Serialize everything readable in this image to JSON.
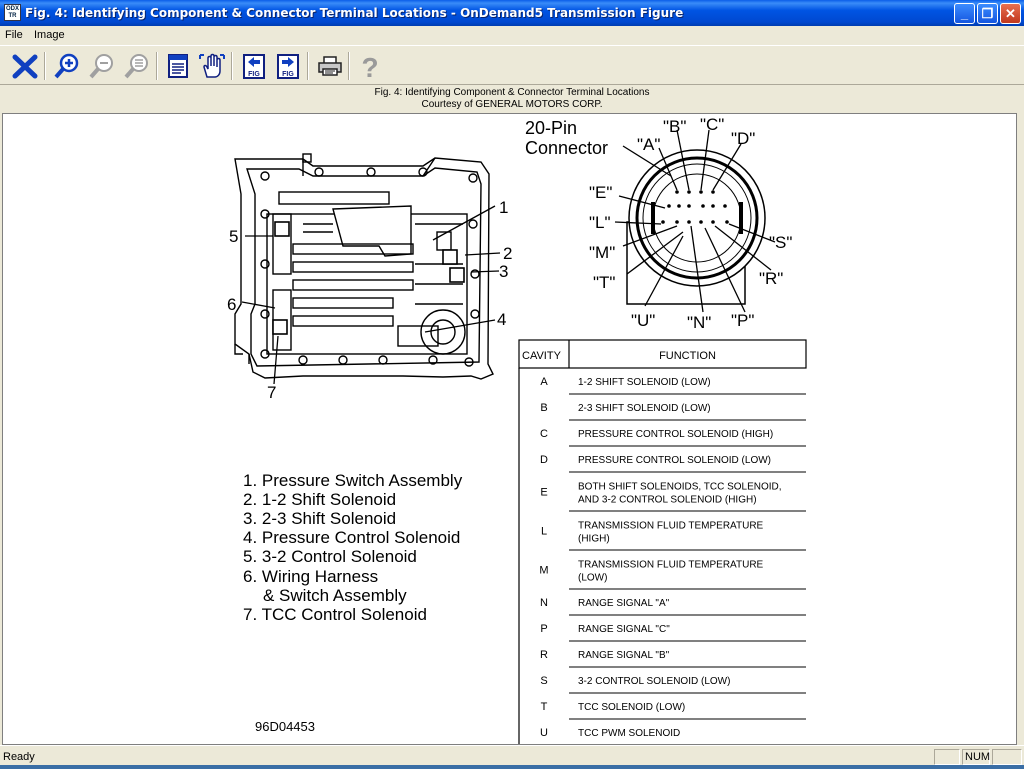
{
  "window": {
    "app_icon_text": "ODX TR",
    "title": "Fig. 4: Identifying Component & Connector Terminal Locations - OnDemand5 Transmission Figure",
    "minimize": "_",
    "maximize": "❐",
    "close": "✕"
  },
  "menu": {
    "file": "File",
    "image": "Image"
  },
  "toolbar": {
    "help_glyph": "?",
    "fig_prev_label": "FIG",
    "fig_next_label": "FIG"
  },
  "caption": {
    "line1": "Fig. 4: Identifying Component & Connector Terminal Locations",
    "line2": "Courtesy of GENERAL MOTORS CORP."
  },
  "figure": {
    "connector_label_1": "20-Pin",
    "connector_label_2": "Connector",
    "pins": [
      "\"A\"",
      "\"B\"",
      "\"C\"",
      "\"D\"",
      "\"E\"",
      "\"L\"",
      "\"M\"",
      "\"T\"",
      "\"U\"",
      "\"N\"",
      "\"P\"",
      "\"R\"",
      "\"S\""
    ],
    "callouts": [
      "1",
      "2",
      "3",
      "4",
      "5",
      "6",
      "7"
    ],
    "legend": [
      "1. Pressure Switch Assembly",
      "2. 1-2 Shift Solenoid",
      "3. 2-3 Shift Solenoid",
      "4. Pressure Control Solenoid",
      "5. 3-2 Control Solenoid",
      "6. Wiring Harness",
      "& Switch Assembly",
      "7. TCC Control Solenoid"
    ],
    "figure_id": "96D04453",
    "table": {
      "headers": [
        "CAVITY",
        "FUNCTION"
      ],
      "rows": [
        [
          "A",
          "1-2 SHIFT SOLENOID (LOW)"
        ],
        [
          "B",
          "2-3 SHIFT SOLENOID (LOW)"
        ],
        [
          "C",
          "PRESSURE CONTROL SOLENOID (HIGH)"
        ],
        [
          "D",
          "PRESSURE CONTROL SOLENOID (LOW)"
        ],
        [
          "E",
          "BOTH SHIFT SOLENOIDS, TCC SOLENOID,",
          "AND 3-2 CONTROL SOLENOID (HIGH)"
        ],
        [
          "L",
          "TRANSMISSION FLUID TEMPERATURE",
          "(HIGH)"
        ],
        [
          "M",
          "TRANSMISSION FLUID TEMPERATURE",
          "(LOW)"
        ],
        [
          "N",
          "RANGE SIGNAL \"A\""
        ],
        [
          "P",
          "RANGE SIGNAL \"C\""
        ],
        [
          "R",
          "RANGE SIGNAL \"B\""
        ],
        [
          "S",
          "3-2 CONTROL SOLENOID (LOW)"
        ],
        [
          "T",
          "TCC SOLENOID (LOW)"
        ],
        [
          "U",
          "TCC PWM SOLENOID"
        ]
      ]
    }
  },
  "status": {
    "text": "Ready",
    "num": "NUM"
  },
  "colors": {
    "titlebar": "#0054e3",
    "chrome": "#ece9d8",
    "toolbar_icon_blue": "#1040c0"
  }
}
